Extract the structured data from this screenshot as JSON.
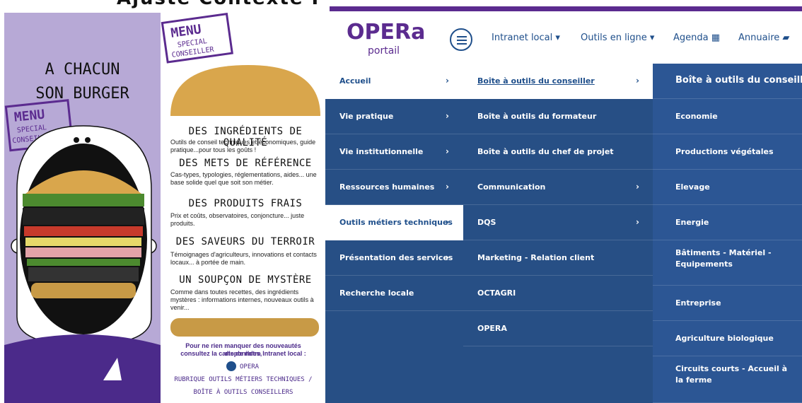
{
  "top_caption": "Ajuste Contexte Portal Secteurs Visuels et Offres Services",
  "poster": {
    "title_line1": "A CHACUN",
    "title_line2": "SON BURGER",
    "stamp": "MENU SPECIAL CONSEILLER"
  },
  "flyer": {
    "stamp": "MENU SPECIAL CONSEILLER",
    "sections": [
      {
        "heading": "DES INGRÉDIENTS DE QUALITÉ",
        "text": "Outils de conseil techniques et économiques, guide pratique...pour tous les goûts !"
      },
      {
        "heading": "DES METS DE RÉFÉRENCE",
        "text": "Cas-types, typologies, réglementations, aides... une base solide quel que soit son métier."
      },
      {
        "heading": "DES PRODUITS FRAIS",
        "text": "Prix et coûts, observatoires, conjoncture... juste produits."
      },
      {
        "heading": "DES SAVEURS DU TERROIR",
        "text": "Témoignages d'agriculteurs, innovations et contacts locaux... à portée de main."
      },
      {
        "heading": "UN SOUPÇON DE MYSTÈRE",
        "text": "Comme dans toutes recettes, des ingrédients mystères : informations internes, nouveaux outils à venir..."
      }
    ],
    "cta_line1": "Pour ne rien manquer des nouveautés disponibles,",
    "cta_line2": "consultez la carte de notre Intranet local :",
    "opera_label": "OPERA",
    "rubrique_line1": "RUBRIQUE OUTILS MÉTIERS TECHNIQUES /",
    "rubrique_line2": "BOÎTE À OUTILS CONSEILLERS"
  },
  "portal": {
    "logo": "OPERa",
    "logo_sub": "portail",
    "nav": [
      {
        "label": "Intranet local",
        "icon": "caret-down-icon"
      },
      {
        "label": "Outils en ligne",
        "icon": "caret-down-icon"
      },
      {
        "label": "Agenda",
        "icon": "calendar-icon"
      },
      {
        "label": "Annuaire",
        "icon": "book-icon"
      }
    ],
    "col1": [
      {
        "label": "Accueil",
        "arrow": true,
        "active": true
      },
      {
        "label": "Vie pratique",
        "arrow": true,
        "active": false
      },
      {
        "label": "Vie institutionnelle",
        "arrow": true,
        "active": false
      },
      {
        "label": "Ressources humaines",
        "arrow": true,
        "active": false
      },
      {
        "label": "Outils métiers techniques",
        "arrow": true,
        "active": true
      },
      {
        "label": "Présentation des services",
        "arrow": true,
        "active": false
      },
      {
        "label": "Recherche locale",
        "arrow": false,
        "active": false
      }
    ],
    "col2": [
      {
        "label": "Boîte à outils du conseiller",
        "arrow": true,
        "active": true
      },
      {
        "label": "Boîte à outils du formateur",
        "arrow": false,
        "active": false
      },
      {
        "label": "Boîte à outils du chef de projet",
        "arrow": false,
        "active": false
      },
      {
        "label": "Communication",
        "arrow": true,
        "active": false
      },
      {
        "label": "DQS",
        "arrow": true,
        "active": false
      },
      {
        "label": "Marketing - Relation client",
        "arrow": false,
        "active": false
      },
      {
        "label": "OCTAGRI",
        "arrow": false,
        "active": false
      },
      {
        "label": "OPERA",
        "arrow": false,
        "active": false
      }
    ],
    "col3": [
      {
        "label": "Boîte à outils du conseiller"
      },
      {
        "label": "Economie"
      },
      {
        "label": "Productions végétales"
      },
      {
        "label": "Elevage"
      },
      {
        "label": "Energie"
      },
      {
        "label": "Bâtiments - Matériel - Equipements"
      },
      {
        "label": "Entreprise"
      },
      {
        "label": "Agriculture biologique"
      },
      {
        "label": "Circuits courts - Accueil à la ferme"
      }
    ],
    "colors": {
      "purple": "#5b2b8f",
      "navy": "#274f85",
      "link": "#1f4f8b"
    }
  }
}
